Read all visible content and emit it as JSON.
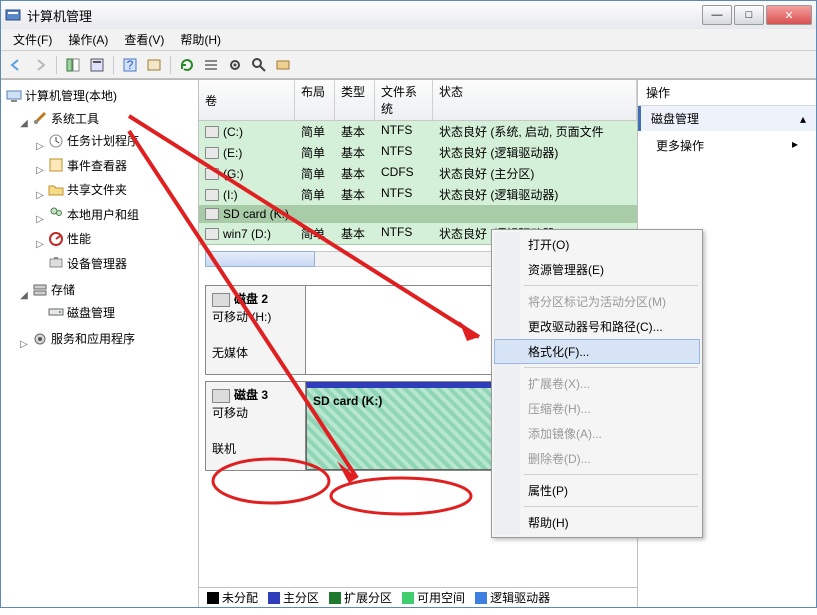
{
  "window": {
    "title": "计算机管理"
  },
  "menu": {
    "file": "文件(F)",
    "operate": "操作(A)",
    "view": "查看(V)",
    "help": "帮助(H)"
  },
  "tree": {
    "root": "计算机管理(本地)",
    "systools": "系统工具",
    "scheduler": "任务计划程序",
    "eventviewer": "事件查看器",
    "shares": "共享文件夹",
    "users": "本地用户和组",
    "perf": "性能",
    "devmgr": "设备管理器",
    "storage": "存储",
    "diskmgmt": "磁盘管理",
    "services": "服务和应用程序"
  },
  "vol": {
    "h": {
      "vol": "卷",
      "layout": "布局",
      "type": "类型",
      "fs": "文件系统",
      "status": "状态"
    },
    "rows": [
      {
        "name": "(C:)",
        "layout": "简单",
        "type": "基本",
        "fs": "NTFS",
        "status": "状态良好 (系统, 启动, 页面文件"
      },
      {
        "name": "(E:)",
        "layout": "简单",
        "type": "基本",
        "fs": "NTFS",
        "status": "状态良好 (逻辑驱动器)"
      },
      {
        "name": "(G:)",
        "layout": "简单",
        "type": "基本",
        "fs": "CDFS",
        "status": "状态良好 (主分区)"
      },
      {
        "name": "(I:)",
        "layout": "简单",
        "type": "基本",
        "fs": "NTFS",
        "status": "状态良好 (逻辑驱动器)"
      },
      {
        "name": "SD card (K:)",
        "layout": "",
        "type": "",
        "fs": "",
        "status": ""
      },
      {
        "name": "win7 (D:)",
        "layout": "简单",
        "type": "基本",
        "fs": "NTFS",
        "status": "状态良好 (逻辑驱动器)"
      }
    ]
  },
  "disks": {
    "d2": {
      "title": "磁盘 2",
      "line1": "可移动 (H:)",
      "line2": "无媒体"
    },
    "d3": {
      "title": "磁盘 3",
      "line1": "可移动",
      "line2": "联机",
      "partlabel": "SD card  (K:)"
    }
  },
  "legend": {
    "unalloc": "未分配",
    "primary": "主分区",
    "extended": "扩展分区",
    "free": "可用空间",
    "logical": "逻辑驱动器"
  },
  "colors": {
    "unalloc": "#000000",
    "primary": "#2f3dbb",
    "extended": "#1f7a2f",
    "free": "#3fcf6f",
    "logical": "#3f7fe0"
  },
  "actions": {
    "header": "操作",
    "diskmgmt": "磁盘管理",
    "more": "更多操作"
  },
  "ctx": {
    "open": "打开(O)",
    "explorer": "资源管理器(E)",
    "markactive": "将分区标记为活动分区(M)",
    "changepath": "更改驱动器号和路径(C)...",
    "format": "格式化(F)...",
    "extend": "扩展卷(X)...",
    "shrink": "压缩卷(H)...",
    "mirror": "添加镜像(A)...",
    "delete": "删除卷(D)...",
    "prop": "属性(P)",
    "help": "帮助(H)"
  }
}
